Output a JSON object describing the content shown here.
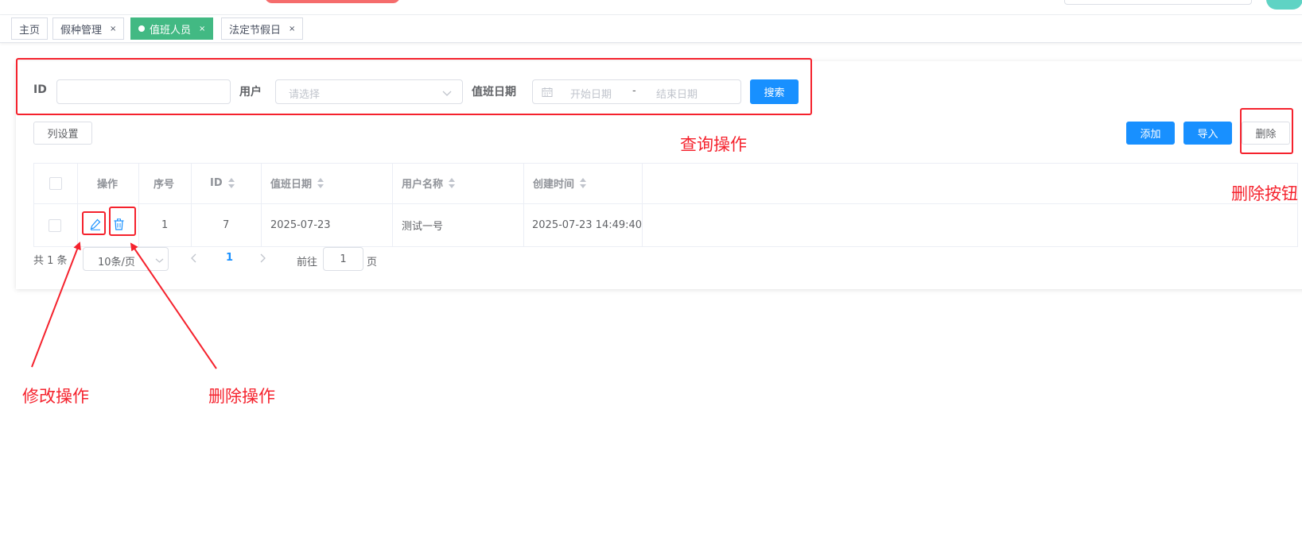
{
  "tabs": [
    {
      "label": "主页",
      "active": false,
      "closable": false
    },
    {
      "label": "假种管理",
      "active": false,
      "closable": true
    },
    {
      "label": "值班人员",
      "active": true,
      "closable": true
    },
    {
      "label": "法定节假日",
      "active": false,
      "closable": true
    }
  ],
  "tab_close_glyph": "×",
  "search": {
    "id_label": "ID",
    "id_value": "",
    "user_label": "用户",
    "user_placeholder": "请选择",
    "date_label": "值班日期",
    "start_placeholder": "开始日期",
    "separator": "-",
    "end_placeholder": "结束日期",
    "search_button": "搜索"
  },
  "toolbar": {
    "columns_button": "列设置",
    "add_button": "添加",
    "import_button": "导入",
    "delete_button": "删除"
  },
  "table": {
    "headers": [
      "操作",
      "序号",
      "ID",
      "值班日期",
      "用户名称",
      "创建时间"
    ],
    "rows": [
      {
        "index": "1",
        "id": "7",
        "duty_date": "2025-07-23",
        "user_name": "测试一号",
        "created_at": "2025-07-23 14:49:40"
      }
    ]
  },
  "pagination": {
    "total": "共 1 条",
    "page_size": "10条/页",
    "current_page": "1",
    "goto_label": "前往",
    "goto_value": "1",
    "page_suffix": "页"
  },
  "annotations": {
    "query": "查询操作",
    "delete_button": "删除按钮",
    "edit": "修改操作",
    "delete_op": "删除操作"
  },
  "colors": {
    "primary": "#1890ff",
    "tab_active": "#42b983",
    "annotation": "#f5222d"
  }
}
